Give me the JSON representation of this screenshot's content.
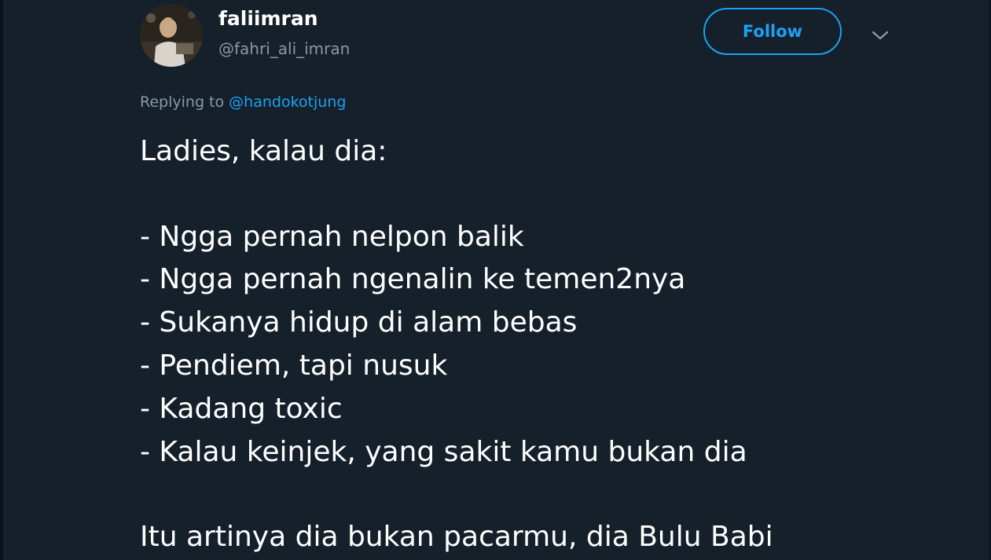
{
  "user": {
    "display_name": "faliimran",
    "handle": "@fahri_ali_imran",
    "avatar_icon": "profile-photo"
  },
  "follow_button": {
    "label": "Follow"
  },
  "menu": {
    "icon": "chevron-down-icon"
  },
  "reply": {
    "prefix": "Replying to",
    "mention": "@handokotjung"
  },
  "tweet": {
    "lines": [
      "Ladies, kalau dia:",
      "- Ngga pernah nelpon balik",
      "- Ngga pernah ngenalin ke temen2nya",
      "- Sukanya hidup di alam bebas",
      "- Pendiem, tapi nusuk",
      "- Kadang toxic",
      "- Kalau keinjek, yang sakit kamu bukan dia",
      "Itu artinya dia bukan pacarmu, dia Bulu Babi"
    ]
  },
  "colors": {
    "background": "#15202b",
    "accent": "#1da1f2",
    "secondary_text": "#8899a6",
    "text": "#ffffff"
  }
}
